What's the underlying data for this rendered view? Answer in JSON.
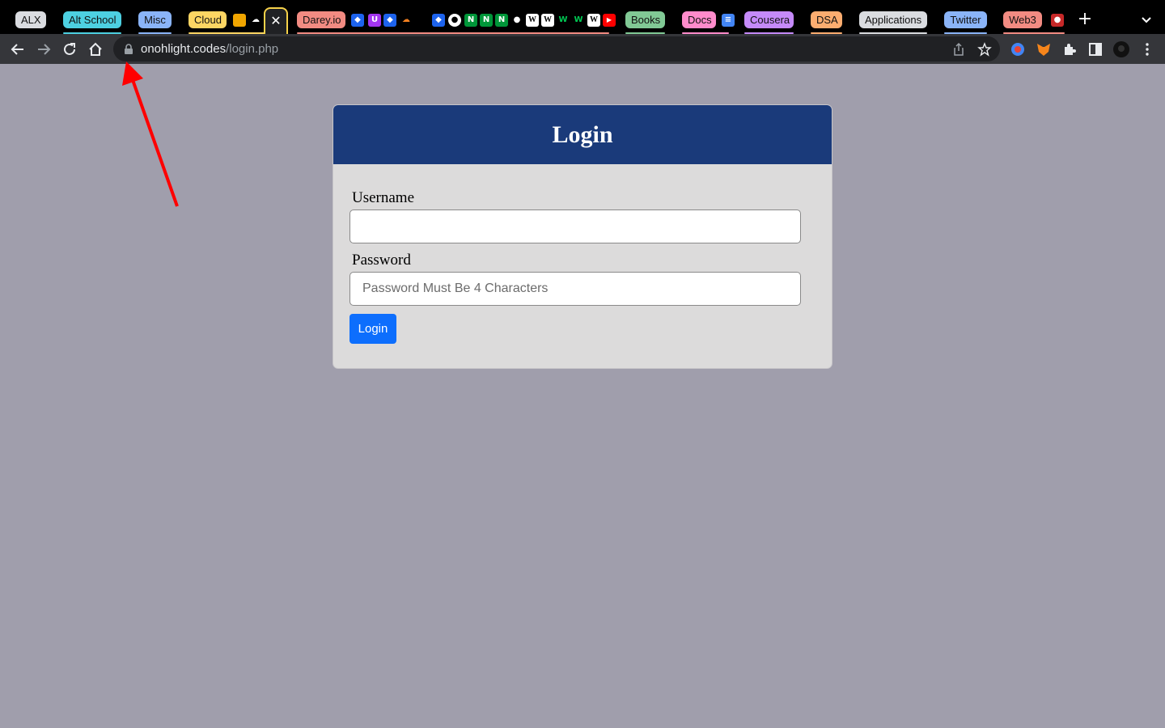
{
  "browser": {
    "tab_groups": [
      {
        "label": "ALX",
        "color": "#dadce0"
      },
      {
        "label": "Alt School",
        "color": "#4dd0e1"
      },
      {
        "label": "Misc",
        "color": "#8ab4f8"
      },
      {
        "label": "Cloud",
        "color": "#fdd663"
      },
      {
        "label": "Darey.io",
        "color": "#f28b82"
      },
      {
        "label": "Books",
        "color": "#81c995"
      },
      {
        "label": "Docs",
        "color": "#ff8bcb"
      },
      {
        "label": "Cousera",
        "color": "#c58af9"
      },
      {
        "label": "DSA",
        "color": "#fcad70"
      },
      {
        "label": "Applications",
        "color": "#dadce0"
      },
      {
        "label": "Twitter",
        "color": "#8ab4f8"
      },
      {
        "label": "Web3",
        "color": "#f28b82"
      }
    ],
    "favicons": [
      "N",
      "N",
      "N",
      "W",
      "W",
      "W",
      "W",
      "W",
      "U"
    ],
    "close_tab_glyph": "✕",
    "new_tab_glyph": "+",
    "address": {
      "host": "onohlight.codes",
      "path": "/login.php"
    }
  },
  "login": {
    "title": "Login",
    "username_label": "Username",
    "username_value": "",
    "password_label": "Password",
    "password_placeholder": "Password Must Be 4 Characters",
    "submit_label": "Login"
  },
  "colors": {
    "page_background": "#a09eac",
    "card_header": "#1a3a7a",
    "card_body": "#dcdbdb",
    "button": "#0d6efd",
    "annotation_arrow": "#ff0000"
  }
}
